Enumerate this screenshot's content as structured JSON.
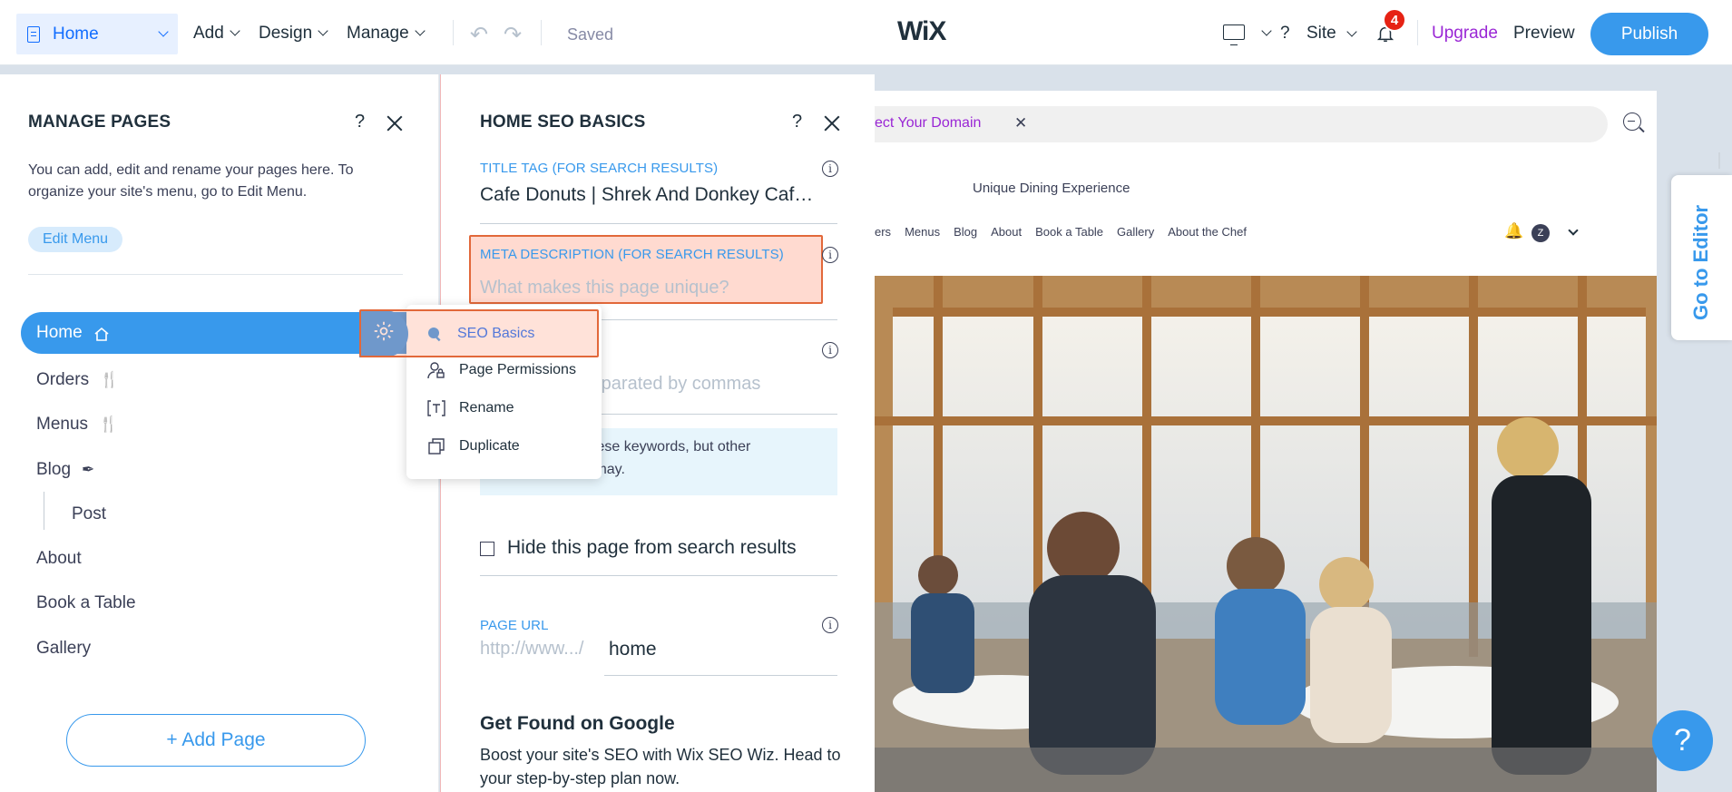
{
  "topbar": {
    "page_selector": "Home",
    "menus": [
      "Add",
      "Design",
      "Manage"
    ],
    "saved_status": "Saved",
    "logo": "WiX",
    "help": "?",
    "site_menu": "Site",
    "notifications_count": "4",
    "upgrade": "Upgrade",
    "preview": "Preview",
    "publish": "Publish"
  },
  "manage_pages": {
    "title": "MANAGE PAGES",
    "help": "?",
    "description": "You can add, edit and rename your pages here. To organize your site's menu, go to Edit Menu.",
    "edit_menu": "Edit Menu",
    "pages": [
      {
        "label": "Home",
        "icon": "house-icon"
      },
      {
        "label": "Orders",
        "icon": "cutlery-icon"
      },
      {
        "label": "Menus",
        "icon": "cutlery-icon"
      },
      {
        "label": "Blog",
        "icon": "pen-icon"
      },
      {
        "label": "Post",
        "icon": ""
      },
      {
        "label": "About",
        "icon": ""
      },
      {
        "label": "Book a Table",
        "icon": ""
      },
      {
        "label": "Gallery",
        "icon": ""
      }
    ],
    "add_page": "+ Add Page"
  },
  "context_menu": {
    "items": [
      {
        "label": "SEO Basics",
        "icon": "search-icon"
      },
      {
        "label": "Page Permissions",
        "icon": "user-lock-icon"
      },
      {
        "label": "Rename",
        "icon": "text-icon"
      },
      {
        "label": "Duplicate",
        "icon": "copy-icon"
      }
    ]
  },
  "seo": {
    "title": "HOME SEO BASICS",
    "help": "?",
    "title_tag_label": "TITLE TAG (FOR SEARCH RESULTS)",
    "title_tag_value": "Cafe Donuts | Shrek And Donkey Caf…",
    "meta_label": "META DESCRIPTION (FOR SEARCH RESULTS)",
    "meta_placeholder": "What makes this page unique?",
    "keywords_placeholder_visible": "s separated by commas",
    "keywords_note_line1": "t use these keywords, but other",
    "keywords_note_line2": "s may.",
    "hide_label": "Hide this page from search results",
    "page_url_label": "PAGE URL",
    "url_prefix": "http://www.../",
    "url_value": "home",
    "google_title": "Get Found on Google",
    "google_desc": "Boost your site's SEO with Wix SEO Wiz. Head to your step-by-step plan now."
  },
  "site_preview": {
    "domain_text": "ect Your Domain",
    "tagline": "Unique Dining Experience",
    "nav": [
      "ers",
      "Menus",
      "Blog",
      "About",
      "Book a Table",
      "Gallery",
      "About the Chef"
    ],
    "avatar_letter": "Z"
  },
  "go_to_editor": "Go to Editor",
  "help_fab": "?",
  "colors": {
    "accent": "#3899ec",
    "upgrade": "#9a27d5",
    "badge": "#e62214",
    "highlight": "#e2683a"
  }
}
